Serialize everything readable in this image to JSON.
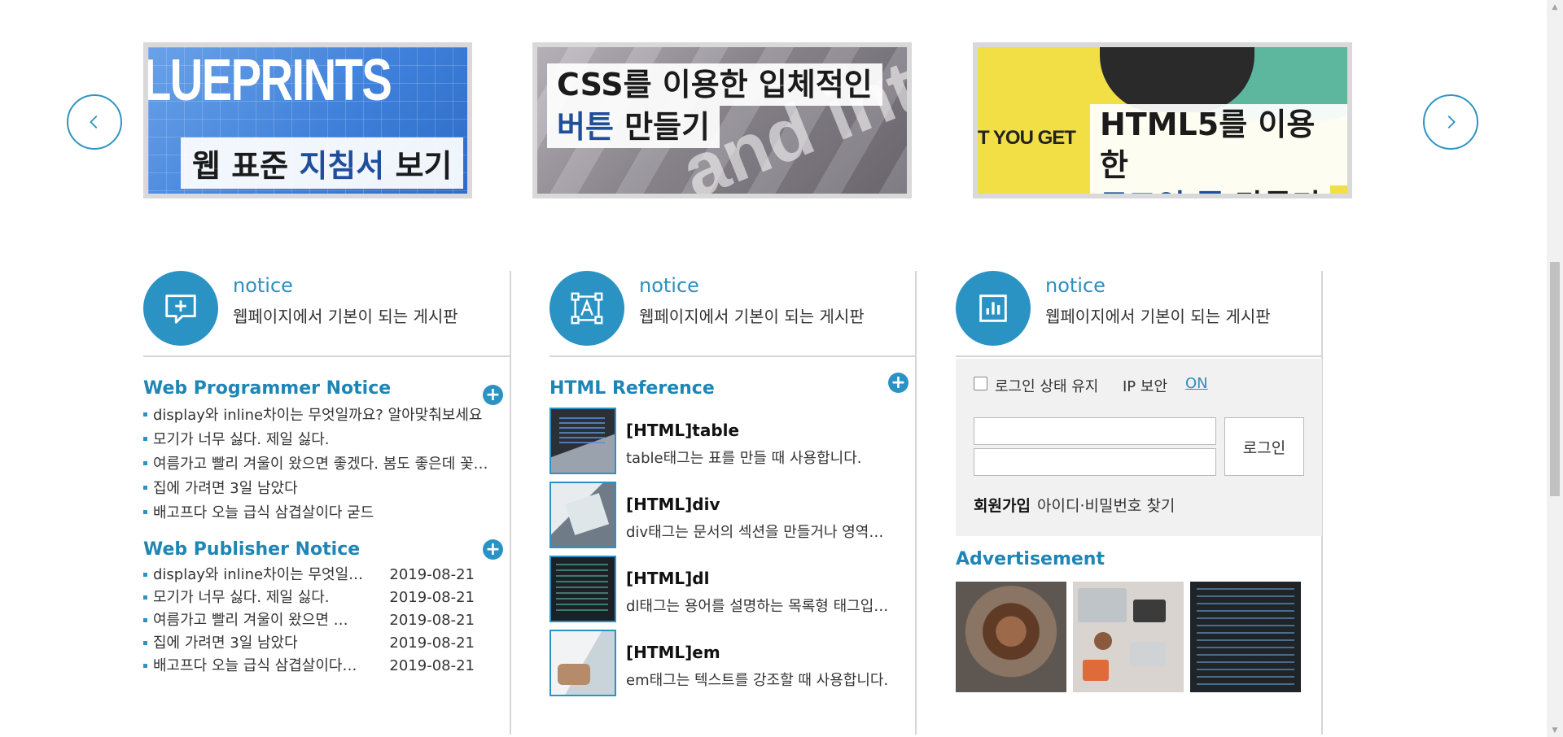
{
  "slider": {
    "prev_icon": "chevron-left-icon",
    "next_icon": "chevron-right-icon",
    "banners": [
      {
        "bg_text": "LUEPRINTS",
        "line1_plain": "웹 표준 ",
        "line1_highlight": "지침서",
        "line1_tail": " 보기"
      },
      {
        "bg_text": "and inte",
        "line1": "CSS를 이용한 입체적인",
        "line2_highlight": "버튼",
        "line2_tail": " 만들기"
      },
      {
        "bg_text": "T YOU GET",
        "line1": "HTML5를 이용한",
        "line2_highlight": "로그인 폼",
        "line2_tail": " 만들기"
      }
    ]
  },
  "columns": [
    {
      "icon": "add-comment-icon",
      "title": "notice",
      "subtitle": "웹페이지에서 기본이 되는 게시판",
      "sections": [
        {
          "title": "Web Programmer Notice",
          "items": [
            "display와 inline차이는 무엇일까요? 알아맞춰보세요",
            "모기가 너무 싫다. 제일 싫다.",
            "여름가고 빨리 겨울이 왔으면 좋겠다. 봄도 좋은데 꽃…",
            "집에 가려면 3일 남았다",
            "배고프다 오늘 급식 삼겹살이다 굳드"
          ]
        },
        {
          "title": "Web Publisher Notice",
          "items": [
            {
              "title": "display와 inline차이는 무엇일…",
              "date": "2019-08-21"
            },
            {
              "title": "모기가 너무 싫다. 제일 싫다.",
              "date": "2019-08-21"
            },
            {
              "title": "여름가고 빨리 겨울이 왔으면 …",
              "date": "2019-08-21"
            },
            {
              "title": "집에 가려면 3일 남았다",
              "date": "2019-08-21"
            },
            {
              "title": "배고프다 오늘 급식 삼겹살이다…",
              "date": "2019-08-21"
            }
          ]
        }
      ]
    },
    {
      "icon": "text-frame-icon",
      "title": "notice",
      "subtitle": "웹페이지에서 기본이 되는 게시판",
      "section_title": "HTML Reference",
      "refs": [
        {
          "title": "[HTML]table",
          "desc": "table태그는 표를 만들 때 사용합니다."
        },
        {
          "title": "[HTML]div",
          "desc": "div태그는 문서의 섹션을 만들거나 영역…"
        },
        {
          "title": "[HTML]dl",
          "desc": "dl태그는 용어를 설명하는 목록형 태그입…"
        },
        {
          "title": "[HTML]em",
          "desc": "em태그는 텍스트를 강조할 때 사용합니다."
        }
      ]
    },
    {
      "icon": "bar-chart-icon",
      "title": "notice",
      "subtitle": "웹페이지에서 기본이 되는 게시판",
      "login": {
        "keep_login": "로그인 상태 유지",
        "ip_security": "IP 보안",
        "ip_on": "ON",
        "button": "로그인",
        "join": "회원가입",
        "find": "아이디·비밀번호 찾기"
      },
      "ad_title": "Advertisement"
    }
  ],
  "colors": {
    "accent": "#2b93c4",
    "divider": "#d5d5d5",
    "login_bg": "#f1f1f1"
  }
}
